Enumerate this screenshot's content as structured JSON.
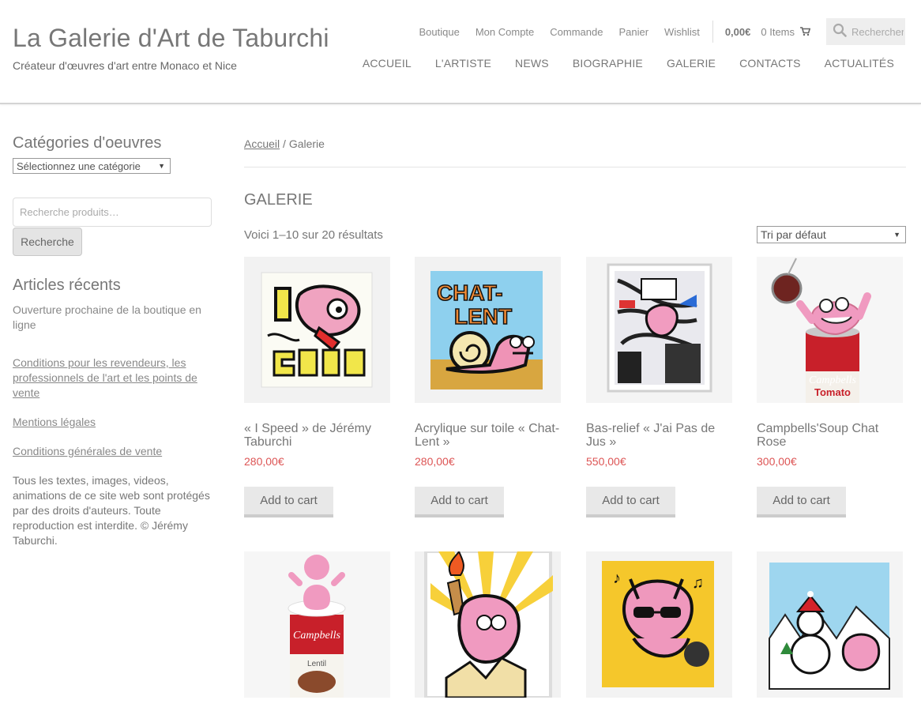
{
  "site": {
    "title": "La Galerie d'Art de Taburchi",
    "description": "Créateur d'œuvres d'art entre Monaco et Nice"
  },
  "topbar": {
    "links": [
      "Boutique",
      "Mon Compte",
      "Commande",
      "Panier",
      "Wishlist"
    ],
    "cart_total": "0,00€",
    "cart_items": "0 Items",
    "search_placeholder": "Rechercher"
  },
  "nav": [
    "ACCUEIL",
    "L'ARTISTE",
    "NEWS",
    "BIOGRAPHIE",
    "GALERIE",
    "CONTACTS",
    "ACTUALITÉS"
  ],
  "sidebar": {
    "categories_title": "Catégories d'oeuvres",
    "category_select": "Sélectionnez une catégorie",
    "product_search_placeholder": "Recherche produits…",
    "search_button": "Recherche",
    "recent_title": "Articles récents",
    "recent_items": [
      "Ouverture prochaine de la boutique en ligne"
    ],
    "links": [
      "Conditions pour les revendeurs, les professionnels de l'art et les points de vente",
      "Mentions légales",
      "Conditions générales de vente"
    ],
    "note": "Tous les textes, images, videos, animations de ce site web sont protégés par des droits d'auteurs. Toute reproduction est interdite. © Jérémy Taburchi."
  },
  "main": {
    "breadcrumb_home": "Accueil",
    "breadcrumb_sep": " / ",
    "breadcrumb_current": "Galerie",
    "page_title": "GALERIE",
    "result_count": "Voici 1–10 sur 20 résultats",
    "sort_select": "Tri par défaut",
    "add_to_cart": "Add to cart",
    "products": [
      {
        "title": "« I Speed » de Jérémy Taburchi",
        "price": "280,00€"
      },
      {
        "title": "Acrylique sur toile « Chat-Lent »",
        "price": "280,00€"
      },
      {
        "title": "Bas-relief « J'ai Pas de Jus »",
        "price": "550,00€"
      },
      {
        "title": "Campbells'Soup Chat Rose",
        "price": "300,00€"
      }
    ]
  },
  "colors": {
    "accent_price": "#dd5555",
    "text": "#777777"
  }
}
